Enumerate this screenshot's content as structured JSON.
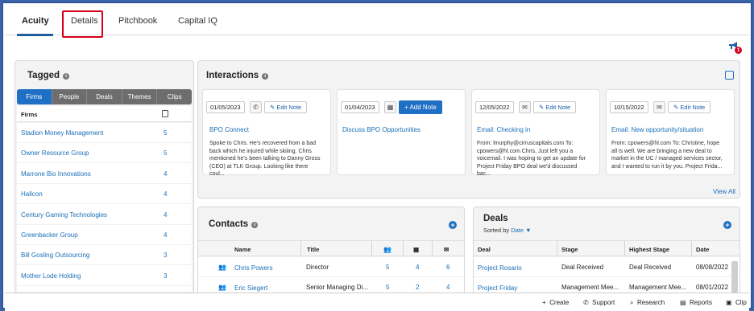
{
  "tabs": [
    "Acuity",
    "Details",
    "Pitchbook",
    "Capital IQ"
  ],
  "notification_count": "1",
  "tagged": {
    "title": "Tagged",
    "segments": [
      "Firms",
      "People",
      "Deals",
      "Themes",
      "Clips"
    ],
    "list_header": "Firms",
    "firms": [
      {
        "name": "Stadion Money Management",
        "count": "5"
      },
      {
        "name": "Owner Resource Group",
        "count": "5"
      },
      {
        "name": "Marrone Bio Innovations",
        "count": "4"
      },
      {
        "name": "Hallcon",
        "count": "4"
      },
      {
        "name": "Century Gaming Technologies",
        "count": "4"
      },
      {
        "name": "Greenbacker Group",
        "count": "4"
      },
      {
        "name": "Bill Gosling Outsourcing",
        "count": "3"
      },
      {
        "name": "Mother Lode Holding",
        "count": "3"
      }
    ]
  },
  "interactions": {
    "title": "Interactions",
    "view_all": "View All",
    "cards": [
      {
        "date": "01/05/2023",
        "type_icon": "phone-icon",
        "button": "Edit Note",
        "subject": "BPO Connect",
        "body": "Spoke to Chris. He's recovered from a bad back which he injured while skiiing. Chris mentioned he's been talking to Danny Gross (CEO) at TLK Group. Looking like there coul..."
      },
      {
        "date": "01/04/2023",
        "type_icon": "calendar-icon",
        "button": "+ Add Note",
        "subject": "Discuss BPO Opportunities",
        "body": ""
      },
      {
        "date": "12/05/2022",
        "type_icon": "mail-icon",
        "button": "Edit Note",
        "subject": "Email: Checking in",
        "body": "From: lmurphy@cirruscapitals.com To: cpowers@hl.com Chris, Just left you a voicemail. I was hoping to get an update for Project Friday BPO deal we'd discussed bac..."
      },
      {
        "date": "10/15/2022",
        "type_icon": "mail-icon",
        "button": "Edit Note",
        "subject": "Email: New opportunity/situation",
        "body": "From: cpowers@hl.com To: Christine, hope all is well. We are bringing a new deal to market in the UC / managed services sector, and I wanted to run it by you. Project Frida..."
      }
    ]
  },
  "contacts": {
    "title": "Contacts",
    "columns": [
      "Name",
      "Title"
    ],
    "rows": [
      {
        "name": "Chris Powers",
        "title": "Director",
        "c1": "5",
        "c2": "4",
        "c3": "6"
      },
      {
        "name": "Eric Siegert",
        "title": "Senior Managing Di...",
        "c1": "5",
        "c2": "2",
        "c3": "4"
      }
    ]
  },
  "deals": {
    "title": "Deals",
    "sorted_by_label": "Sorted by",
    "sorted_by_value": "Date",
    "columns": [
      "Deal",
      "Stage",
      "Highest Stage",
      "Date"
    ],
    "rows": [
      {
        "deal": "Project Rosario",
        "stage": "Deal Received",
        "highest": "Deal Received",
        "date": "08/08/2022"
      },
      {
        "deal": "Project Friday",
        "stage": "Management Mee...",
        "highest": "Management Mee...",
        "date": "08/01/2022"
      }
    ]
  },
  "footer": [
    "Create",
    "Support",
    "Research",
    "Reports",
    "Clip"
  ],
  "colors": {
    "accent": "#1f6fc4",
    "link": "#1a6fb8",
    "highlight": "#d4001a"
  }
}
